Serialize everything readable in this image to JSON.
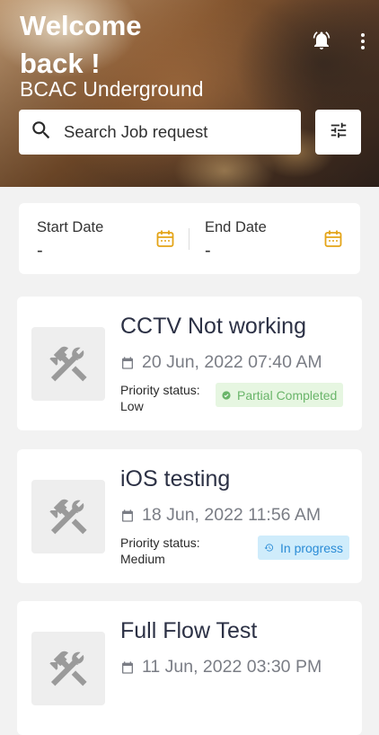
{
  "header": {
    "welcome": "Welcome back !",
    "subtitle": "BCAC Underground"
  },
  "search": {
    "placeholder": "Search Job request"
  },
  "dates": {
    "start_label": "Start Date",
    "start_value": "-",
    "end_label": "End Date",
    "end_value": "-"
  },
  "jobs": [
    {
      "title": "CCTV Not working",
      "date": "20 Jun, 2022 07:40 AM",
      "priority_label": "Priority status:",
      "priority": "Low",
      "status": "Partial Completed"
    },
    {
      "title": "iOS testing",
      "date": "18 Jun, 2022 11:56 AM",
      "priority_label": "Priority status:",
      "priority": "Medium",
      "status": "In progress"
    },
    {
      "title": "Full Flow Test",
      "date": "11 Jun, 2022 03:30 PM"
    }
  ],
  "colors": {
    "accent_calendar": "#e4a417",
    "status_partial_bg": "#e6f6e1",
    "status_partial_text": "#6ab56a",
    "status_progress_bg": "#cfecfb",
    "status_progress_text": "#2a8bd6"
  },
  "icons": [
    "bell-icon",
    "more-vert-icon",
    "search-icon",
    "filter-sliders-icon",
    "calendar-icon",
    "tools-icon",
    "check-circle-icon",
    "history-icon"
  ]
}
